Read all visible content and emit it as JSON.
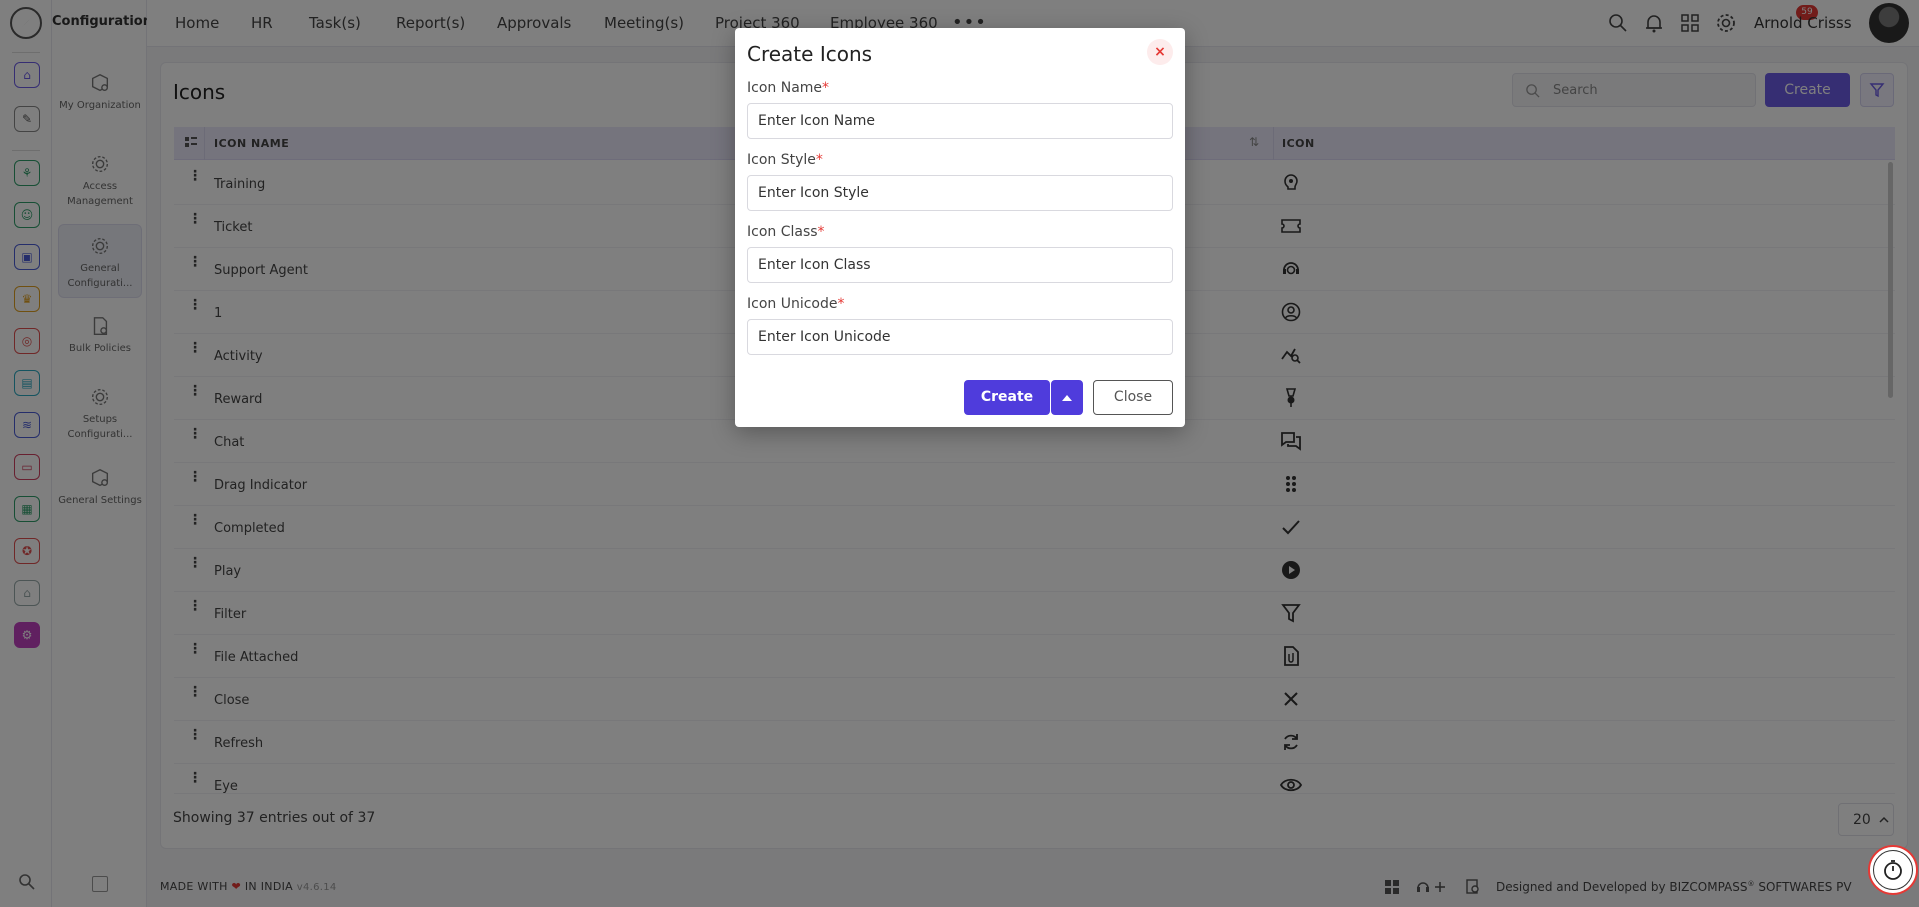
{
  "app": {
    "section_title": "Configuration"
  },
  "config_menu": [
    {
      "label": "My Organization",
      "icon": "cube-gear-icon"
    },
    {
      "label": "Access Management",
      "icon": "gear-icon"
    },
    {
      "label": "General Configurati...",
      "icon": "gear-icon",
      "active": true
    },
    {
      "label": "Bulk Policies",
      "icon": "document-gear-icon"
    },
    {
      "label": "Setups Configurati...",
      "icon": "gear-icon"
    },
    {
      "label": "General Settings",
      "icon": "cube-gear-icon"
    }
  ],
  "nav": {
    "items": [
      "Home",
      "HR",
      "Task(s)",
      "Report(s)",
      "Approvals",
      "Meeting(s)",
      "Project 360",
      "Employee 360"
    ],
    "more": "•••",
    "notification_count": "59",
    "user_name": "Arnold Crisss"
  },
  "page": {
    "title": "Icons",
    "search_placeholder": "Search",
    "create_label": "Create"
  },
  "table": {
    "headers": {
      "name": "ICON NAME",
      "icon": "ICON"
    },
    "sort_glyph": "⇅",
    "rows": [
      {
        "name": "Training",
        "icon": "training-icon"
      },
      {
        "name": "Ticket",
        "icon": "ticket-icon"
      },
      {
        "name": "Support Agent",
        "icon": "support-agent-icon"
      },
      {
        "name": "1",
        "icon": "user-circle-icon"
      },
      {
        "name": "Activity",
        "icon": "activity-icon"
      },
      {
        "name": "Reward",
        "icon": "reward-icon"
      },
      {
        "name": "Chat",
        "icon": "chat-icon"
      },
      {
        "name": "Drag Indicator",
        "icon": "drag-indicator-icon"
      },
      {
        "name": "Completed",
        "icon": "check-icon"
      },
      {
        "name": "Play",
        "icon": "play-icon"
      },
      {
        "name": "Filter",
        "icon": "filter-icon"
      },
      {
        "name": "File Attached",
        "icon": "file-attached-icon"
      },
      {
        "name": "Close",
        "icon": "close-icon"
      },
      {
        "name": "Refresh",
        "icon": "refresh-icon"
      },
      {
        "name": "Eye",
        "icon": "eye-icon"
      }
    ],
    "footer": "Showing 37 entries out of 37",
    "page_size": "20"
  },
  "bottom": {
    "made_prefix": "MADE WITH",
    "made_heart": "❤",
    "made_suffix": "IN INDIA",
    "version": "v4.6.14",
    "designed_prefix": "Designed and Developed by",
    "company": "BIZCOMPASS",
    "company_mark": "®",
    "company_suffix": "SOFTWARES PV"
  },
  "modal": {
    "title": "Create Icons",
    "close_glyph": "×",
    "fields": [
      {
        "label": "Icon Name",
        "placeholder": "Enter Icon Name"
      },
      {
        "label": "Icon Style",
        "placeholder": "Enter Icon Style"
      },
      {
        "label": "Icon Class",
        "placeholder": "Enter Icon Class"
      },
      {
        "label": "Icon Unicode",
        "placeholder": "Enter Icon Unicode"
      }
    ],
    "required_mark": "*",
    "create_label": "Create",
    "close_label": "Close"
  },
  "colors": {
    "accent": "#6c5ce7",
    "accent_dark": "#4f3cdc",
    "danger": "#e53935",
    "table_header": "#eae8fb"
  }
}
